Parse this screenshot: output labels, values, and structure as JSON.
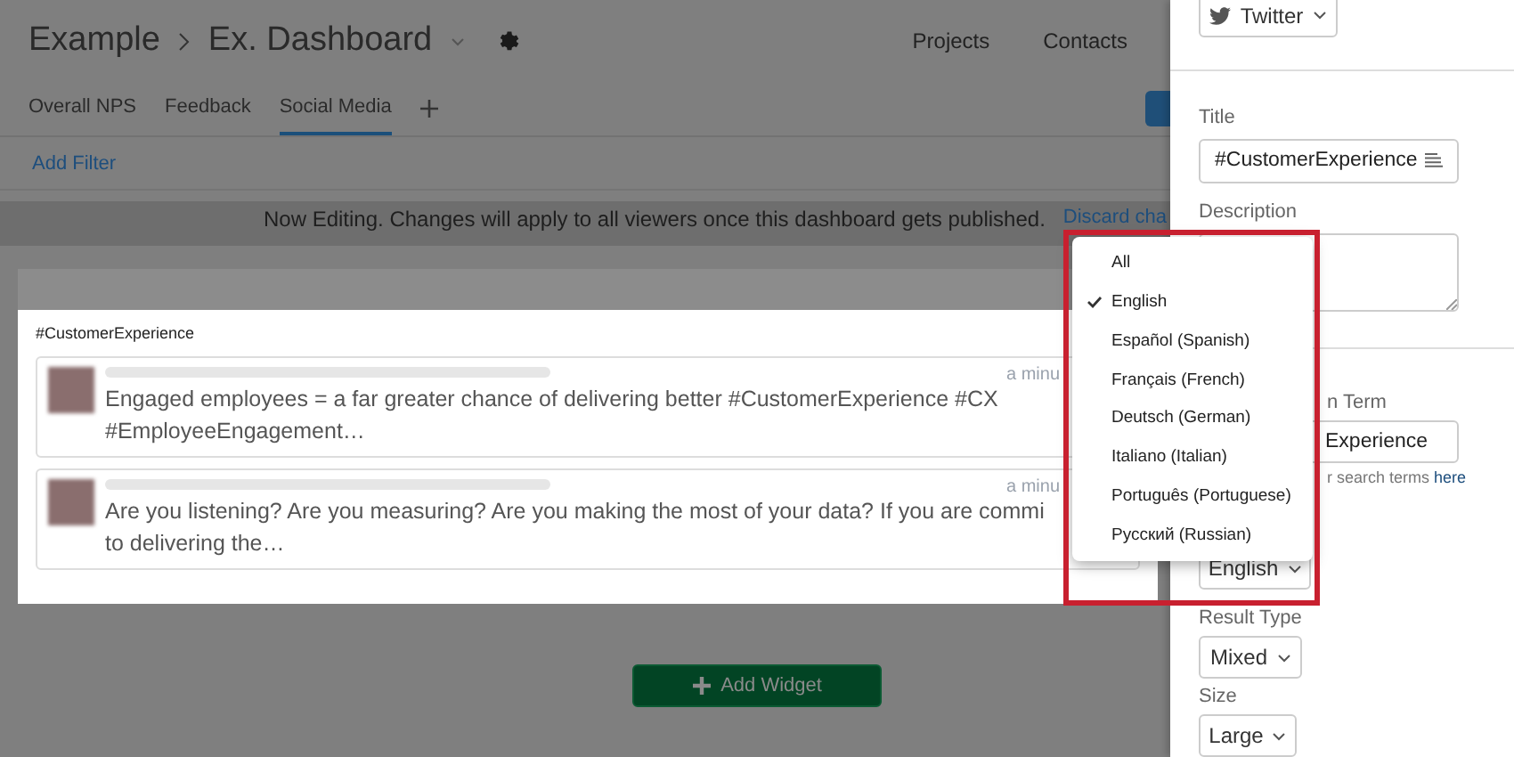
{
  "header": {
    "breadcrumb": [
      "Example",
      "Ex. Dashboard"
    ],
    "nav": [
      "Projects",
      "Contacts"
    ]
  },
  "tabs": [
    {
      "label": "Overall NPS",
      "selected": false
    },
    {
      "label": "Feedback",
      "selected": false
    },
    {
      "label": "Social Media",
      "selected": true
    }
  ],
  "filter": {
    "add_filter": "Add Filter"
  },
  "notice": {
    "text": "Now Editing. Changes will apply to all viewers once this dashboard gets published.",
    "link": "Discard cha"
  },
  "widget": {
    "title": "#CustomerExperience",
    "posts": [
      {
        "lines": [
          "Engaged employees = a far greater chance of delivering better #CustomerExperience #CX",
          "#EmployeeEngagement…"
        ],
        "time": "a minu"
      },
      {
        "lines": [
          "Are you listening? Are you measuring? Are you making the most of your data? If you are commi",
          "to delivering the…"
        ],
        "time": "a minu"
      }
    ]
  },
  "add_widget": "Add Widget",
  "panel": {
    "source": "Twitter",
    "title_label": "Title",
    "title_value": "#CustomerExperience",
    "description_label": "Description",
    "search_label": "n Term",
    "search_value": "Experience",
    "help_text": "r search terms",
    "help_link": "here",
    "language": "English",
    "result_type_label": "Result Type",
    "result_type": "Mixed",
    "size_label": "Size",
    "size": "Large"
  },
  "language_menu": [
    {
      "label": "All",
      "selected": false
    },
    {
      "label": "English",
      "selected": true
    },
    {
      "label": "Español (Spanish)",
      "selected": false
    },
    {
      "label": "Français (French)",
      "selected": false
    },
    {
      "label": "Deutsch (German)",
      "selected": false
    },
    {
      "label": "Italiano (Italian)",
      "selected": false
    },
    {
      "label": "Português (Portuguese)",
      "selected": false
    },
    {
      "label": "Русский (Russian)",
      "selected": false
    }
  ]
}
